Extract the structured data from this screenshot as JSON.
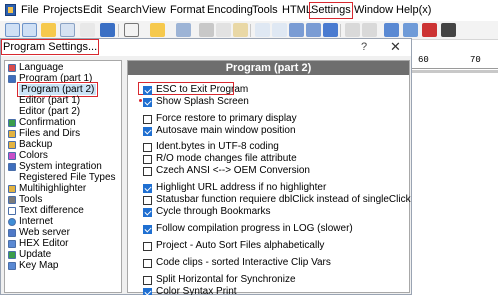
{
  "menu": {
    "items": [
      "File",
      "Projects",
      "Edit",
      "Search",
      "View",
      "Format",
      "Encoding",
      "Tools",
      "HTML",
      "Settings",
      "Window",
      "Help(x)"
    ],
    "highlighted": "Settings"
  },
  "ruler": {
    "labels": [
      "60",
      "70"
    ]
  },
  "dialog": {
    "title": "Program Settings...",
    "help_glyph": "?",
    "close_glyph": "✕",
    "tree": [
      "Language",
      "Program  (part 1)",
      "Program  (part 2)",
      "Editor  (part 1)",
      "Editor  (part 2)",
      "Confirmation",
      "Files and Dirs",
      "Backup",
      "Colors",
      "System integration",
      "Registered File Types",
      "Multihighlighter",
      "Tools",
      "Text difference",
      "Internet",
      "Web server",
      "HEX Editor",
      "Update",
      "Key Map"
    ],
    "selected_tree_item": "Program  (part 2)",
    "panel": {
      "header": "Program  (part 2)",
      "options": [
        {
          "label": "ESC to Exit Program",
          "checked": true
        },
        {
          "label": "Show Splash Screen",
          "checked": true
        },
        {
          "label": "Force restore to primary display",
          "checked": false
        },
        {
          "label": "Autosave main window position",
          "checked": true
        },
        {
          "label": "Ident.bytes in UTF-8 coding",
          "checked": false
        },
        {
          "label": "R/O mode changes file attribute",
          "checked": false
        },
        {
          "label": "Czech ANSI <--> OEM Conversion",
          "checked": false
        },
        {
          "label": "Highlight URL address if no highlighter",
          "checked": true
        },
        {
          "label": "Statusbar function requiere dblClick instead of singleClick",
          "checked": false
        },
        {
          "label": "Cycle through Bookmarks",
          "checked": true
        },
        {
          "label": "Follow compilation progress in LOG (slower)",
          "checked": true
        },
        {
          "label": "Project - Auto Sort Files alphabetically",
          "checked": false
        },
        {
          "label": "Code clips - sorted Interactive Clip Vars",
          "checked": false
        },
        {
          "label": "Split Horizontal for Synchronize",
          "checked": false
        },
        {
          "label": "Color Syntax Print",
          "checked": true
        }
      ]
    }
  },
  "colors": {
    "highlight_red": "#d8282f",
    "checkbox_blue": "#1f6fd1",
    "panel_header": "#6e6e6e"
  }
}
